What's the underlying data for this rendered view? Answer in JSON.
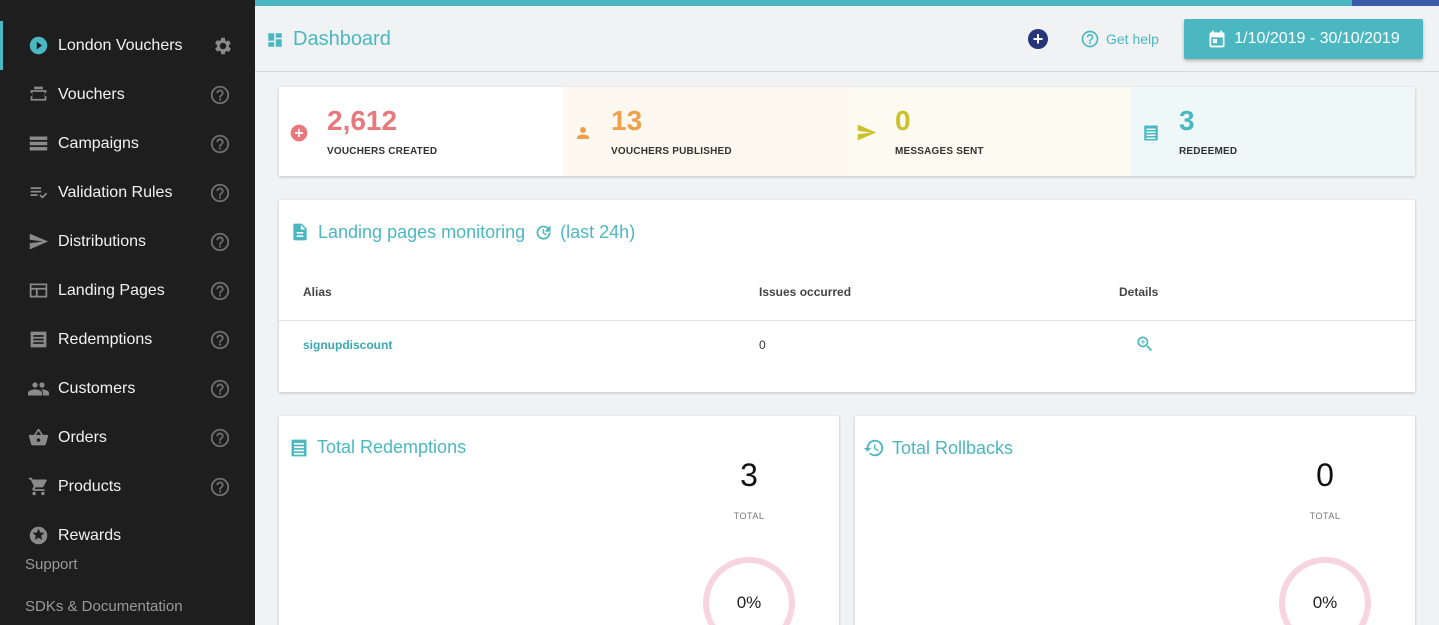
{
  "sidebar": {
    "items": [
      {
        "label": "London Vouchers",
        "icon": "play-circle-icon",
        "active": true
      },
      {
        "label": "Vouchers",
        "icon": "voucher-icon"
      },
      {
        "label": "Campaigns",
        "icon": "campaigns-icon"
      },
      {
        "label": "Validation Rules",
        "icon": "validation-rules-icon"
      },
      {
        "label": "Distributions",
        "icon": "send-icon"
      },
      {
        "label": "Landing Pages",
        "icon": "landing-page-icon"
      },
      {
        "label": "Redemptions",
        "icon": "receipt-icon"
      },
      {
        "label": "Customers",
        "icon": "people-icon"
      },
      {
        "label": "Orders",
        "icon": "basket-icon"
      },
      {
        "label": "Products",
        "icon": "cart-icon"
      },
      {
        "label": "Rewards",
        "icon": "star-icon"
      }
    ],
    "support": "Support",
    "sdks": "SDKs & Documentation"
  },
  "header": {
    "title": "Dashboard",
    "help": "Get help",
    "date_range": "1/10/2019 - 30/10/2019"
  },
  "stats": [
    {
      "value": "2,612",
      "label": "VOUCHERS CREATED",
      "color": "#e8787c",
      "bg": "#ffffff",
      "icon": "add-circle-icon"
    },
    {
      "value": "13",
      "label": "VOUCHERS PUBLISHED",
      "color": "#f0a04b",
      "bg": "#fdf8f0",
      "icon": "person-icon"
    },
    {
      "value": "0",
      "label": "MESSAGES SENT",
      "color": "#c9c22d",
      "bg": "#fdfaf1",
      "icon": "send-icon"
    },
    {
      "value": "3",
      "label": "REDEEMED",
      "color": "#4bb8c1",
      "bg": "#eef8f8",
      "icon": "receipt-icon"
    }
  ],
  "landing": {
    "title": "Landing pages monitoring",
    "period": "(last 24h)",
    "columns": [
      "Alias",
      "Issues occurred",
      "Details"
    ],
    "rows": [
      {
        "alias": "signupdiscount",
        "issues": "0"
      }
    ]
  },
  "redemptions": {
    "title": "Total Redemptions",
    "total": "3",
    "total_label": "TOTAL",
    "percent": "0%"
  },
  "rollbacks": {
    "title": "Total Rollbacks",
    "total": "0",
    "total_label": "TOTAL",
    "percent": "0%"
  }
}
